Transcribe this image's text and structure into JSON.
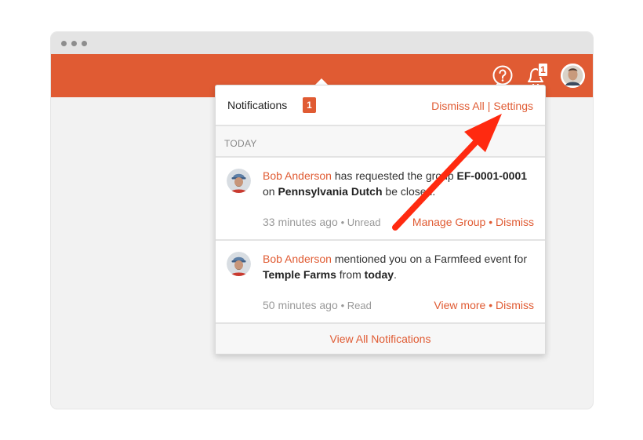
{
  "header": {
    "bell_count": "1"
  },
  "panel": {
    "title": "Notifications",
    "count": "1",
    "dismiss_all": "Dismiss All",
    "separator": "|",
    "settings": "Settings",
    "section": "TODAY",
    "footer": "View All Notifications"
  },
  "notifications": [
    {
      "actor": "Bob Anderson",
      "text1": " has requested the group ",
      "bold1": "EF-0001-0001",
      "text2": " on ",
      "bold2": "Pennsylvania Dutch",
      "text3": " be closed.",
      "time": "33 minutes ago",
      "status": "• Unread",
      "action": "Manage Group",
      "action_sep": " • ",
      "dismiss": "Dismiss"
    },
    {
      "actor": "Bob Anderson",
      "text1": " mentioned you on a Farmfeed event for ",
      "bold1": "Temple Farms",
      "text2": " from ",
      "bold2": "today",
      "text3": ".",
      "time": "50 minutes ago",
      "status": "• Read",
      "action": "View more",
      "action_sep": " • ",
      "dismiss": "Dismiss"
    }
  ],
  "colors": {
    "accent": "#e05b33",
    "arrow": "#ff2a10"
  }
}
